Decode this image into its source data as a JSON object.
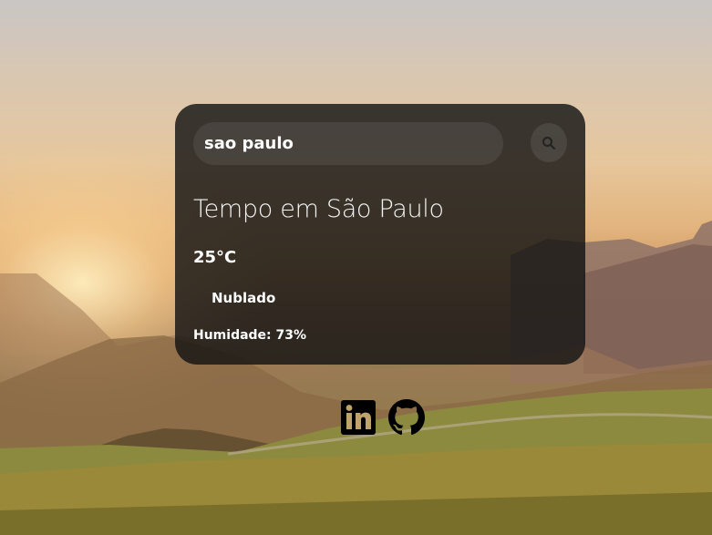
{
  "search": {
    "value": "sao paulo",
    "placeholder": "",
    "button_icon": "search-icon"
  },
  "weather": {
    "title": "Tempo em São Paulo",
    "temperature": "25°C",
    "condition": "Nublado",
    "condition_icon": "cloud-icon",
    "humidity_label": "Humidade:",
    "humidity_value": "73%"
  },
  "social": {
    "icons": [
      "linkedin-icon",
      "github-icon"
    ]
  },
  "colors": {
    "card_background": "#141414",
    "text": "#ffffff"
  }
}
